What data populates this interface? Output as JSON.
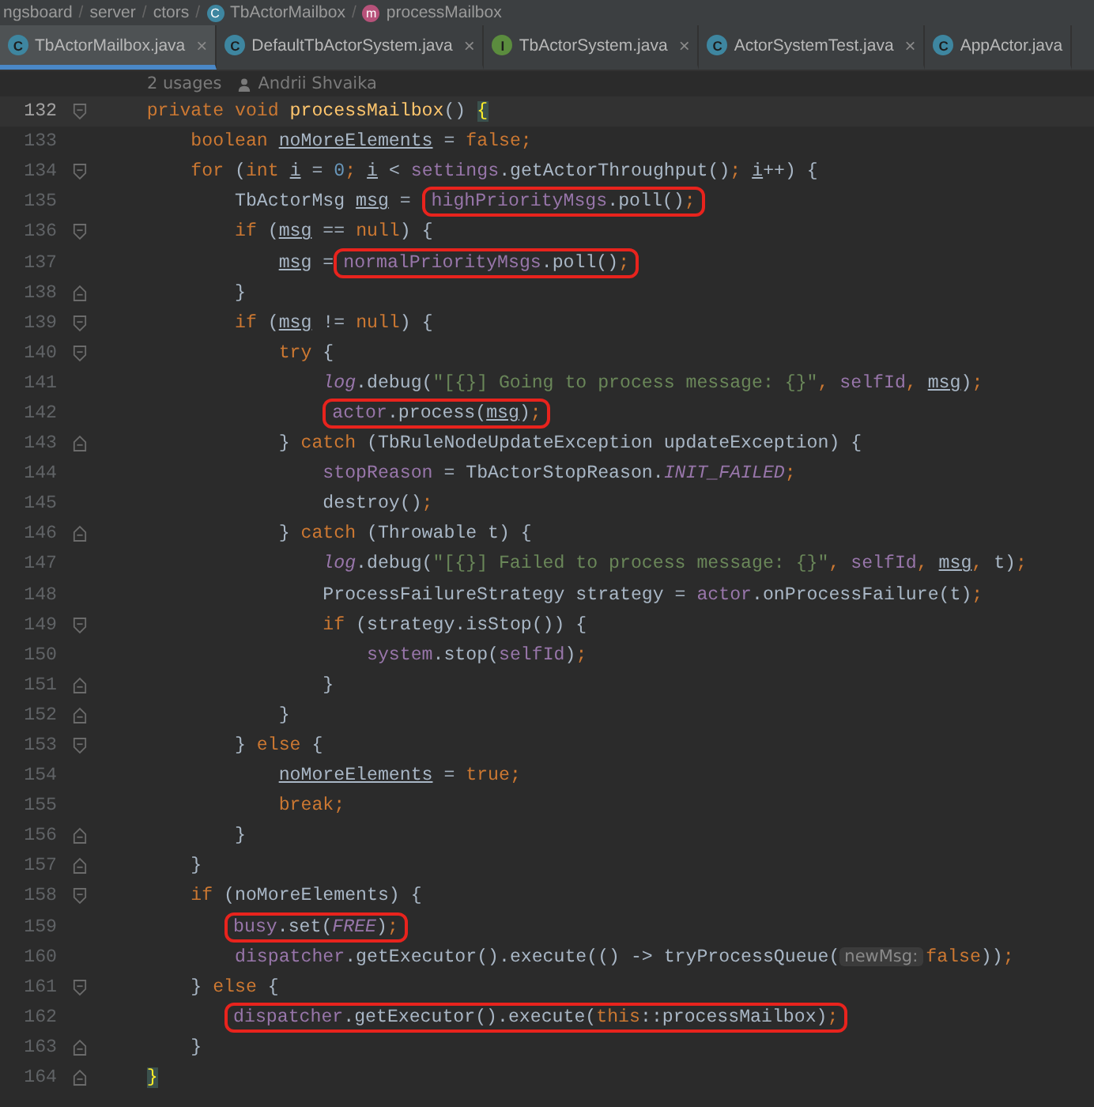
{
  "breadcrumbs": [
    {
      "label": "ngsboard"
    },
    {
      "label": "server"
    },
    {
      "label": "ctors"
    },
    {
      "label": "TbActorMailbox",
      "icon": "C"
    },
    {
      "label": "processMailbox",
      "icon": "m"
    }
  ],
  "separator": "/",
  "tabs": [
    {
      "label": "TbActorMailbox.java",
      "icon": "C",
      "color": "#3e86a0",
      "selected": true,
      "closable": true
    },
    {
      "label": "DefaultTbActorSystem.java",
      "icon": "C",
      "color": "#3e86a0",
      "selected": false,
      "closable": true
    },
    {
      "label": "TbActorSystem.java",
      "icon": "I",
      "color": "#5b8c3e",
      "selected": false,
      "closable": true
    },
    {
      "label": "ActorSystemTest.java",
      "icon": "C",
      "color": "#3e86a0",
      "selected": false,
      "closable": true
    },
    {
      "label": "AppActor.java",
      "icon": "C",
      "color": "#3e86a0",
      "selected": false,
      "closable": false
    }
  ],
  "close_glyph": "×",
  "usages": "2 usages",
  "author": "Andrii Shvaika",
  "lines": [
    {
      "number": "132",
      "fold": {
        "kind": "start"
      },
      "current": true,
      "segments": [
        {
          "kind": "code",
          "tokens": [
            {
              "t": "    private void ",
              "kind": "kw"
            },
            {
              "t": "processMailbox",
              "kind": "m"
            },
            {
              "t": "() ",
              "kind": "p"
            },
            {
              "t": "{",
              "kind": "brace"
            }
          ]
        }
      ]
    },
    {
      "number": "133",
      "current": false,
      "segments": [
        {
          "kind": "code",
          "tokens": [
            {
              "t": "        boolean ",
              "kind": "kw"
            },
            {
              "t": "noMoreElements",
              "kind": "u"
            },
            {
              "t": " = ",
              "kind": "p"
            },
            {
              "t": "false;",
              "kind": "kw"
            }
          ]
        }
      ]
    },
    {
      "number": "134",
      "fold": {
        "kind": "start"
      },
      "current": false,
      "segments": [
        {
          "kind": "code",
          "tokens": [
            {
              "t": "        for",
              "kind": "kw"
            },
            {
              "t": " (",
              "kind": "p"
            },
            {
              "t": "int ",
              "kind": "kw"
            },
            {
              "t": "i",
              "kind": "u"
            },
            {
              "t": " = ",
              "kind": "p"
            },
            {
              "t": "0",
              "kind": "n"
            },
            {
              "t": "; ",
              "kind": "kw"
            },
            {
              "t": "i",
              "kind": "u"
            },
            {
              "t": " < ",
              "kind": "p"
            },
            {
              "t": "settings",
              "kind": "f"
            },
            {
              "t": ".getActorThroughput()",
              "kind": "p"
            },
            {
              "t": "; ",
              "kind": "kw"
            },
            {
              "t": "i",
              "kind": "u"
            },
            {
              "t": "++) {",
              "kind": "p"
            }
          ]
        }
      ]
    },
    {
      "number": "135",
      "current": false,
      "segments": [
        {
          "kind": "code",
          "tokens": [
            {
              "t": "            TbActorMsg ",
              "kind": "p"
            },
            {
              "t": "msg",
              "kind": "u"
            },
            {
              "t": " = ",
              "kind": "p"
            }
          ]
        },
        {
          "kind": "box",
          "tokens": [
            {
              "t": "highPriorityMsgs",
              "kind": "f"
            },
            {
              "t": ".poll()",
              "kind": "p"
            },
            {
              "t": ";",
              "kind": "kw"
            }
          ]
        }
      ]
    },
    {
      "number": "136",
      "fold": {
        "kind": "start"
      },
      "current": false,
      "segments": [
        {
          "kind": "code",
          "tokens": [
            {
              "t": "            if",
              "kind": "kw"
            },
            {
              "t": " (",
              "kind": "p"
            },
            {
              "t": "msg",
              "kind": "u"
            },
            {
              "t": " == ",
              "kind": "p"
            },
            {
              "t": "null",
              "kind": "kw"
            },
            {
              "t": ") {",
              "kind": "p"
            }
          ]
        }
      ]
    },
    {
      "number": "137",
      "current": false,
      "segments": [
        {
          "kind": "code",
          "tokens": [
            {
              "t": "                msg",
              "kind": "u"
            },
            {
              "t": " =",
              "kind": "p"
            }
          ]
        },
        {
          "kind": "box",
          "tokens": [
            {
              "t": "normalPriorityMsgs",
              "kind": "f"
            },
            {
              "t": ".poll()",
              "kind": "p"
            },
            {
              "t": ";",
              "kind": "kw"
            }
          ]
        }
      ]
    },
    {
      "number": "138",
      "fold": {
        "kind": "end"
      },
      "current": false,
      "segments": [
        {
          "kind": "code",
          "tokens": [
            {
              "t": "            }",
              "kind": "p"
            }
          ]
        }
      ]
    },
    {
      "number": "139",
      "fold": {
        "kind": "start"
      },
      "current": false,
      "segments": [
        {
          "kind": "code",
          "tokens": [
            {
              "t": "            if",
              "kind": "kw"
            },
            {
              "t": " (",
              "kind": "p"
            },
            {
              "t": "msg",
              "kind": "u"
            },
            {
              "t": " != ",
              "kind": "p"
            },
            {
              "t": "null",
              "kind": "kw"
            },
            {
              "t": ") {",
              "kind": "p"
            }
          ]
        }
      ]
    },
    {
      "number": "140",
      "fold": {
        "kind": "start"
      },
      "current": false,
      "segments": [
        {
          "kind": "code",
          "tokens": [
            {
              "t": "                try",
              "kind": "kw"
            },
            {
              "t": " {",
              "kind": "p"
            }
          ]
        }
      ]
    },
    {
      "number": "141",
      "current": false,
      "segments": [
        {
          "kind": "code",
          "tokens": [
            {
              "t": "                    log",
              "kind": "sf"
            },
            {
              "t": ".debug(",
              "kind": "p"
            },
            {
              "t": "\"[{}] Going to process message: {}\"",
              "kind": "s"
            },
            {
              "t": ", ",
              "kind": "kw"
            },
            {
              "t": "selfId",
              "kind": "f"
            },
            {
              "t": ", ",
              "kind": "kw"
            },
            {
              "t": "msg",
              "kind": "u"
            },
            {
              "t": ")",
              "kind": "p"
            },
            {
              "t": ";",
              "kind": "kw"
            }
          ]
        }
      ]
    },
    {
      "number": "142",
      "current": false,
      "segments": [
        {
          "kind": "box",
          "tokens": [
            {
              "t": "                    actor",
              "kind": "f"
            },
            {
              "t": ".process(",
              "kind": "p"
            },
            {
              "t": "msg",
              "kind": "u"
            },
            {
              "t": ")",
              "kind": "p"
            },
            {
              "t": ";",
              "kind": "kw"
            }
          ]
        }
      ]
    },
    {
      "number": "143",
      "fold": {
        "kind": "end"
      },
      "current": false,
      "segments": [
        {
          "kind": "code",
          "tokens": [
            {
              "t": "                } ",
              "kind": "p"
            },
            {
              "t": "catch",
              "kind": "kw"
            },
            {
              "t": " (TbRuleNodeUpdateException updateException) {",
              "kind": "p"
            }
          ]
        }
      ]
    },
    {
      "number": "144",
      "current": false,
      "segments": [
        {
          "kind": "code",
          "tokens": [
            {
              "t": "                    stopReason",
              "kind": "f"
            },
            {
              "t": " = TbActorStopReason.",
              "kind": "p"
            },
            {
              "t": "INIT_FAILED",
              "kind": "sf"
            },
            {
              "t": ";",
              "kind": "kw"
            }
          ]
        }
      ]
    },
    {
      "number": "145",
      "current": false,
      "segments": [
        {
          "kind": "code",
          "tokens": [
            {
              "t": "                    destroy()",
              "kind": "p"
            },
            {
              "t": ";",
              "kind": "kw"
            }
          ]
        }
      ]
    },
    {
      "number": "146",
      "fold": {
        "kind": "end"
      },
      "current": false,
      "segments": [
        {
          "kind": "code",
          "tokens": [
            {
              "t": "                } ",
              "kind": "p"
            },
            {
              "t": "catch",
              "kind": "kw"
            },
            {
              "t": " (Throwable t) {",
              "kind": "p"
            }
          ]
        }
      ]
    },
    {
      "number": "147",
      "current": false,
      "segments": [
        {
          "kind": "code",
          "tokens": [
            {
              "t": "                    log",
              "kind": "sf"
            },
            {
              "t": ".debug(",
              "kind": "p"
            },
            {
              "t": "\"[{}] Failed to process message: {}\"",
              "kind": "s"
            },
            {
              "t": ", ",
              "kind": "kw"
            },
            {
              "t": "selfId",
              "kind": "f"
            },
            {
              "t": ", ",
              "kind": "kw"
            },
            {
              "t": "msg",
              "kind": "u"
            },
            {
              "t": ", ",
              "kind": "kw"
            },
            {
              "t": "t)",
              "kind": "p"
            },
            {
              "t": ";",
              "kind": "kw"
            }
          ]
        }
      ]
    },
    {
      "number": "148",
      "current": false,
      "segments": [
        {
          "kind": "code",
          "tokens": [
            {
              "t": "                    ProcessFailureStrategy strategy = ",
              "kind": "p"
            },
            {
              "t": "actor",
              "kind": "f"
            },
            {
              "t": ".onProcessFailure(t)",
              "kind": "p"
            },
            {
              "t": ";",
              "kind": "kw"
            }
          ]
        }
      ]
    },
    {
      "number": "149",
      "fold": {
        "kind": "start"
      },
      "current": false,
      "segments": [
        {
          "kind": "code",
          "tokens": [
            {
              "t": "                    if",
              "kind": "kw"
            },
            {
              "t": " (strategy.isStop()) {",
              "kind": "p"
            }
          ]
        }
      ]
    },
    {
      "number": "150",
      "current": false,
      "segments": [
        {
          "kind": "code",
          "tokens": [
            {
              "t": "                        system",
              "kind": "f"
            },
            {
              "t": ".stop(",
              "kind": "p"
            },
            {
              "t": "selfId",
              "kind": "f"
            },
            {
              "t": ")",
              "kind": "p"
            },
            {
              "t": ";",
              "kind": "kw"
            }
          ]
        }
      ]
    },
    {
      "number": "151",
      "fold": {
        "kind": "end"
      },
      "current": false,
      "segments": [
        {
          "kind": "code",
          "tokens": [
            {
              "t": "                    }",
              "kind": "p"
            }
          ]
        }
      ]
    },
    {
      "number": "152",
      "fold": {
        "kind": "end"
      },
      "current": false,
      "segments": [
        {
          "kind": "code",
          "tokens": [
            {
              "t": "                }",
              "kind": "p"
            }
          ]
        }
      ]
    },
    {
      "number": "153",
      "fold": {
        "kind": "start"
      },
      "current": false,
      "segments": [
        {
          "kind": "code",
          "tokens": [
            {
              "t": "            } ",
              "kind": "p"
            },
            {
              "t": "else",
              "kind": "kw"
            },
            {
              "t": " {",
              "kind": "p"
            }
          ]
        }
      ]
    },
    {
      "number": "154",
      "current": false,
      "segments": [
        {
          "kind": "code",
          "tokens": [
            {
              "t": "                noMoreElements",
              "kind": "u"
            },
            {
              "t": " = ",
              "kind": "p"
            },
            {
              "t": "true;",
              "kind": "kw"
            }
          ]
        }
      ]
    },
    {
      "number": "155",
      "current": false,
      "segments": [
        {
          "kind": "code",
          "tokens": [
            {
              "t": "                break;",
              "kind": "kw"
            }
          ]
        }
      ]
    },
    {
      "number": "156",
      "fold": {
        "kind": "end"
      },
      "current": false,
      "segments": [
        {
          "kind": "code",
          "tokens": [
            {
              "t": "            }",
              "kind": "p"
            }
          ]
        }
      ]
    },
    {
      "number": "157",
      "fold": {
        "kind": "end"
      },
      "current": false,
      "segments": [
        {
          "kind": "code",
          "tokens": [
            {
              "t": "        }",
              "kind": "p"
            }
          ]
        }
      ]
    },
    {
      "number": "158",
      "fold": {
        "kind": "start"
      },
      "current": false,
      "segments": [
        {
          "kind": "code",
          "tokens": [
            {
              "t": "        if",
              "kind": "kw"
            },
            {
              "t": " (noMoreElements) {",
              "kind": "p"
            }
          ]
        }
      ]
    },
    {
      "number": "159",
      "current": false,
      "segments": [
        {
          "kind": "box",
          "tokens": [
            {
              "t": "           busy",
              "kind": "f"
            },
            {
              "t": ".set(",
              "kind": "p"
            },
            {
              "t": "FREE",
              "kind": "sf"
            },
            {
              "t": ")",
              "kind": "p"
            },
            {
              "t": ";",
              "kind": "kw"
            }
          ]
        }
      ]
    },
    {
      "number": "160",
      "current": false,
      "segments": [
        {
          "kind": "code",
          "tokens": [
            {
              "t": "            dispatcher",
              "kind": "f"
            },
            {
              "t": ".getExecutor().execute(() -> tryProcessQueue(",
              "kind": "p"
            }
          ]
        },
        {
          "kind": "hint",
          "tokens": [
            {
              "t": "newMsg:",
              "kind": "p"
            }
          ]
        },
        {
          "kind": "code",
          "tokens": [
            {
              "t": "false",
              "kind": "kw"
            },
            {
              "t": "))",
              "kind": "p"
            },
            {
              "t": ";",
              "kind": "kw"
            }
          ]
        }
      ]
    },
    {
      "number": "161",
      "fold": {
        "kind": "start"
      },
      "current": false,
      "segments": [
        {
          "kind": "code",
          "tokens": [
            {
              "t": "        } ",
              "kind": "p"
            },
            {
              "t": "else",
              "kind": "kw"
            },
            {
              "t": " {",
              "kind": "p"
            }
          ]
        }
      ]
    },
    {
      "number": "162",
      "current": false,
      "segments": [
        {
          "kind": "box",
          "tokens": [
            {
              "t": "           dispatcher",
              "kind": "f"
            },
            {
              "t": ".getExecutor().execute(",
              "kind": "p"
            },
            {
              "t": "this",
              "kind": "kw"
            },
            {
              "t": "::processMailbox)",
              "kind": "p"
            },
            {
              "t": ";",
              "kind": "kw"
            }
          ]
        }
      ]
    },
    {
      "number": "163",
      "fold": {
        "kind": "end"
      },
      "current": false,
      "segments": [
        {
          "kind": "code",
          "tokens": [
            {
              "t": "        }",
              "kind": "p"
            }
          ]
        }
      ]
    },
    {
      "number": "164",
      "fold": {
        "kind": "end"
      },
      "current": false,
      "segments": [
        {
          "kind": "code",
          "tokens": [
            {
              "t": "    }",
              "kind": "brace"
            }
          ]
        }
      ]
    }
  ]
}
